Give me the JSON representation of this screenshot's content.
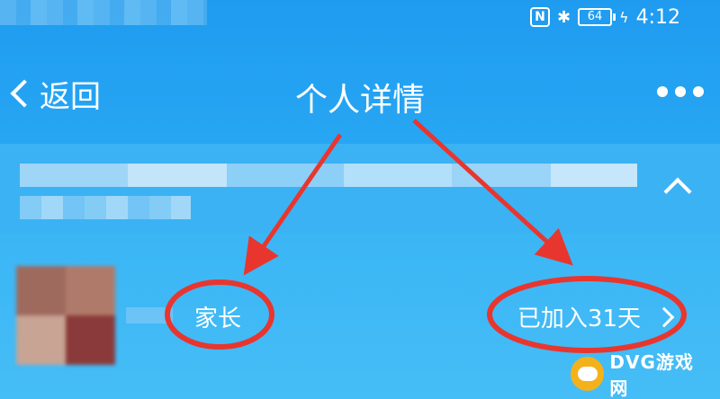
{
  "status_bar": {
    "battery": "64",
    "time": "4:12"
  },
  "nav": {
    "back_label": "返回",
    "title": "个人详情"
  },
  "profile": {
    "role_tag": "家长",
    "joined_text": "已加入31天"
  },
  "watermark": {
    "text": "DVG游戏网"
  },
  "colors": {
    "background": "#2ea4ef",
    "annotation_red": "#e8362f",
    "watermark_logo": "#f3b21b"
  }
}
